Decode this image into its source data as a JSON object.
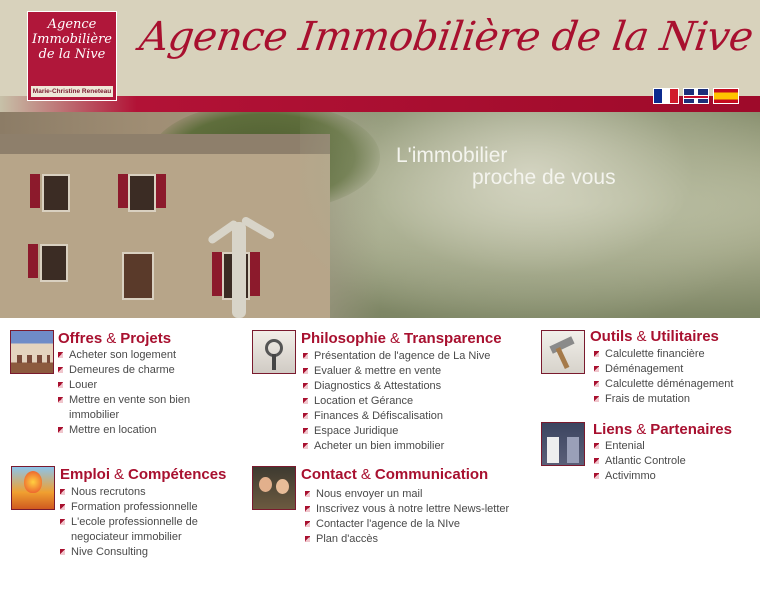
{
  "header": {
    "logo": {
      "lines": [
        "Agence",
        "Immobilière",
        "de la Nive"
      ],
      "subtitle": "Marie-Christine Reneteau"
    },
    "title": "Agence Immobilière de la Nive",
    "flags": [
      {
        "name": "flag-france-icon",
        "lang": "fr"
      },
      {
        "name": "flag-uk-icon",
        "lang": "en"
      },
      {
        "name": "flag-spain-icon",
        "lang": "es"
      }
    ]
  },
  "hero": {
    "slogan_line1": "L'immobilier",
    "slogan_line2": "proche de vous"
  },
  "sections": {
    "offres": {
      "title_part1": "Offres",
      "amp": "&",
      "title_part2": "Projets",
      "items": [
        "Acheter son logement",
        "Demeures de charme",
        "Louer",
        "Mettre en vente son bien",
        "immobilier",
        "Mettre en location"
      ]
    },
    "philosophie": {
      "title_part1": "Philosophie",
      "amp": "&",
      "title_part2": "Transparence",
      "items": [
        "Présentation de l'agence de La Nive",
        "Evaluer & mettre en vente",
        "Diagnostics & Attestations",
        "Location et Gérance",
        "Finances & Défiscalisation",
        "Espace Juridique",
        "Acheter un bien immobilier"
      ]
    },
    "outils": {
      "title_part1": "Outils",
      "amp": "&",
      "title_part2": "Utilitaires",
      "items": [
        "Calculette financière",
        "Déménagement",
        "Calculette déménagement",
        "Frais de mutation"
      ]
    },
    "liens": {
      "title_part1": "Liens",
      "amp": "&",
      "title_part2": "Partenaires",
      "items": [
        "Entenial",
        "Atlantic Controle",
        "Activimmo"
      ]
    },
    "emploi": {
      "title_part1": "Emploi",
      "amp": "&",
      "title_part2": "Compétences",
      "items": [
        "Nous recrutons",
        "Formation professionnelle",
        "L'ecole professionnelle de",
        "negociateur immobilier",
        "Nive Consulting"
      ]
    },
    "contact": {
      "title_part1": "Contact",
      "amp": "&",
      "title_part2": "Communication",
      "items": [
        "Nous envoyer un mail",
        "Inscrivez vous à notre lettre News-letter",
        "Contacter l'agence de la NIve",
        "Plan d'accès"
      ]
    }
  },
  "colors": {
    "brand": "#a8102f",
    "header_bg": "#d8d2bc",
    "text": "#4a4a4a"
  }
}
